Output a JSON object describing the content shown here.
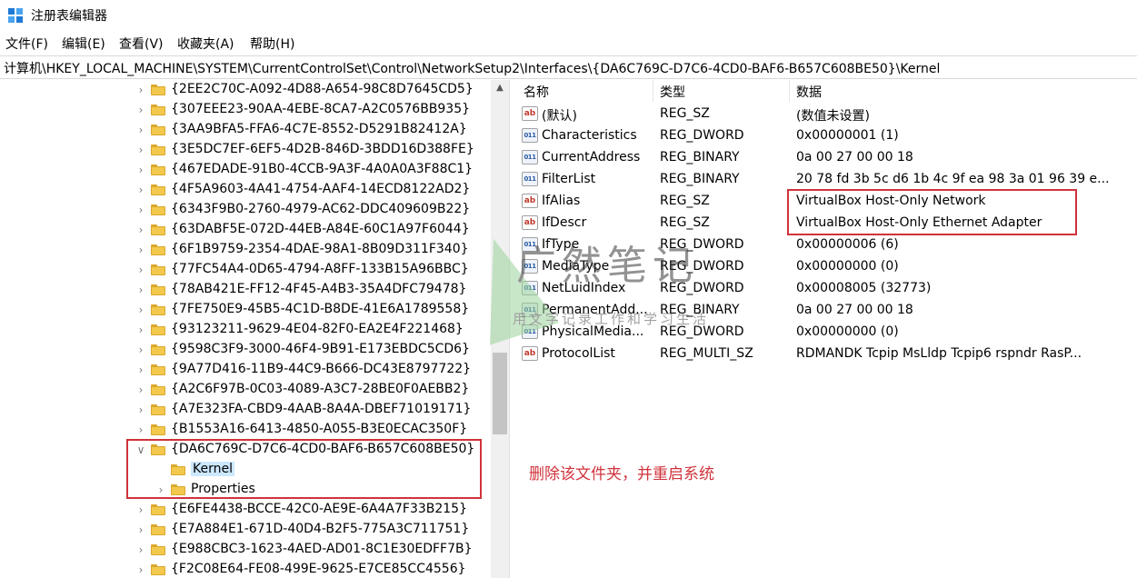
{
  "window": {
    "title": "注册表编辑器"
  },
  "menu": [
    "文件(F)",
    "编辑(E)",
    "查看(V)",
    "收藏夹(A)",
    "帮助(H)"
  ],
  "address": "计算机\\HKEY_LOCAL_MACHINE\\SYSTEM\\CurrentControlSet\\Control\\NetworkSetup2\\Interfaces\\{DA6C769C-D7C6-4CD0-BAF6-B657C608BE50}\\Kernel",
  "tree": [
    {
      "label": "{2EE2C70C-A092-4D88-A654-98C8D7645CD5}",
      "indent": 0,
      "chevron": ">"
    },
    {
      "label": "{307EEE23-90AA-4EBE-8CA7-A2C0576BB935}",
      "indent": 0,
      "chevron": ">"
    },
    {
      "label": "{3AA9BFA5-FFA6-4C7E-8552-D5291B82412A}",
      "indent": 0,
      "chevron": ">"
    },
    {
      "label": "{3E5DC7EF-6EF5-4D2B-846D-3BDD16D388FE}",
      "indent": 0,
      "chevron": ">"
    },
    {
      "label": "{467EDADE-91B0-4CCB-9A3F-4A0A0A3F88C1}",
      "indent": 0,
      "chevron": ">"
    },
    {
      "label": "{4F5A9603-4A41-4754-AAF4-14ECD8122AD2}",
      "indent": 0,
      "chevron": ">"
    },
    {
      "label": "{6343F9B0-2760-4979-AC62-DDC409609B22}",
      "indent": 0,
      "chevron": ">"
    },
    {
      "label": "{63DABF5E-072D-44EB-A84E-60C1A97F6044}",
      "indent": 0,
      "chevron": ">"
    },
    {
      "label": "{6F1B9759-2354-4DAE-98A1-8B09D311F340}",
      "indent": 0,
      "chevron": ">"
    },
    {
      "label": "{77FC54A4-0D65-4794-A8FF-133B15A96BBC}",
      "indent": 0,
      "chevron": ">"
    },
    {
      "label": "{78AB421E-FF12-4F45-A4B3-35A4DFC79478}",
      "indent": 0,
      "chevron": ">"
    },
    {
      "label": "{7FE750E9-45B5-4C1D-B8DE-41E6A1789558}",
      "indent": 0,
      "chevron": ">"
    },
    {
      "label": "{93123211-9629-4E04-82F0-EA2E4F221468}",
      "indent": 0,
      "chevron": ">"
    },
    {
      "label": "{9598C3F9-3000-46F4-9B91-E173EBDC5CD6}",
      "indent": 0,
      "chevron": ">"
    },
    {
      "label": "{9A77D416-11B9-44C9-B666-DC43E8797722}",
      "indent": 0,
      "chevron": ">"
    },
    {
      "label": "{A2C6F97B-0C03-4089-A3C7-28BE0F0AEBB2}",
      "indent": 0,
      "chevron": ">"
    },
    {
      "label": "{A7E323FA-CBD9-4AAB-8A4A-DBEF71019171}",
      "indent": 0,
      "chevron": ">"
    },
    {
      "label": "{B1553A16-6413-4850-A055-B3E0ECAC350F}",
      "indent": 0,
      "chevron": ">"
    },
    {
      "label": "{DA6C769C-D7C6-4CD0-BAF6-B657C608BE50}",
      "indent": 0,
      "chevron": "v"
    },
    {
      "label": "Kernel",
      "indent": 1,
      "chevron": "",
      "selected": true
    },
    {
      "label": "Properties",
      "indent": 1,
      "chevron": ">"
    },
    {
      "label": "{E6FE4438-BCCE-42C0-AE9E-6A4A7F33B215}",
      "indent": 0,
      "chevron": ">"
    },
    {
      "label": "{E7A884E1-671D-40D4-B2F5-775A3C711751}",
      "indent": 0,
      "chevron": ">"
    },
    {
      "label": "{E988CBC3-1623-4AED-AD01-8C1E30EDFF7B}",
      "indent": 0,
      "chevron": ">"
    },
    {
      "label": "{F2C08E64-FE08-499E-9625-E7CE85CC4556}",
      "indent": 0,
      "chevron": ">"
    }
  ],
  "columns": {
    "name": "名称",
    "type": "类型",
    "data": "数据"
  },
  "values": [
    {
      "icon": "ab",
      "name": "(默认)",
      "type": "REG_SZ",
      "data": "(数值未设置)"
    },
    {
      "icon": "bin",
      "name": "Characteristics",
      "type": "REG_DWORD",
      "data": "0x00000001 (1)"
    },
    {
      "icon": "bin",
      "name": "CurrentAddress",
      "type": "REG_BINARY",
      "data": "0a 00 27 00 00 18"
    },
    {
      "icon": "bin",
      "name": "FilterList",
      "type": "REG_BINARY",
      "data": "20 78 fd 3b 5c d6 1b 4c 9f ea 98 3a 01 96 39 e..."
    },
    {
      "icon": "ab",
      "name": "IfAlias",
      "type": "REG_SZ",
      "data": "VirtualBox Host-Only Network"
    },
    {
      "icon": "ab",
      "name": "IfDescr",
      "type": "REG_SZ",
      "data": "VirtualBox Host-Only Ethernet Adapter"
    },
    {
      "icon": "bin",
      "name": "IfType",
      "type": "REG_DWORD",
      "data": "0x00000006 (6)"
    },
    {
      "icon": "bin",
      "name": "MediaType",
      "type": "REG_DWORD",
      "data": "0x00000000 (0)"
    },
    {
      "icon": "bin",
      "name": "NetLuidIndex",
      "type": "REG_DWORD",
      "data": "0x00008005 (32773)"
    },
    {
      "icon": "bin",
      "name": "PermanentAdd...",
      "type": "REG_BINARY",
      "data": "0a 00 27 00 00 18"
    },
    {
      "icon": "bin",
      "name": "PhysicalMedia...",
      "type": "REG_DWORD",
      "data": "0x00000000 (0)"
    },
    {
      "icon": "ab",
      "name": "ProtocolList",
      "type": "REG_MULTI_SZ",
      "data": "RDMANDK Tcpip MsLldp Tcpip6 rspndr RasP..."
    }
  ],
  "annotation": "删除该文件夹，并重启系统",
  "watermark": {
    "title": "广然笔记",
    "subtitle": "用文字记录工作和学习生活"
  },
  "colors": {
    "highlight": "#d0323b",
    "selection": "#cce8ff",
    "folder": "#f2c94c"
  }
}
